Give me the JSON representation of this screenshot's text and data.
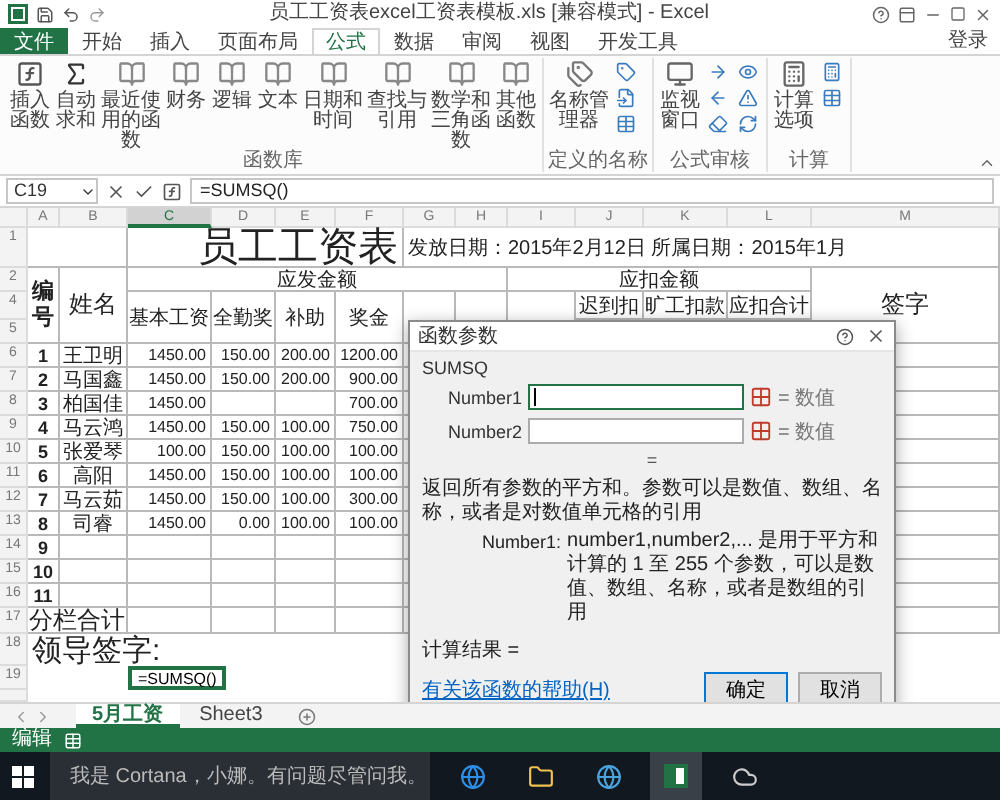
{
  "title_bar": {
    "title": "员工工资表excel工资表模板.xls [兼容模式] - Excel",
    "signin": "登录"
  },
  "ribbon_tabs": [
    {
      "label": "文件",
      "selected": false,
      "kind": "file"
    },
    {
      "label": "开始",
      "selected": false,
      "kind": "tab"
    },
    {
      "label": "插入",
      "selected": false,
      "kind": "tab"
    },
    {
      "label": "页面布局",
      "selected": false,
      "kind": "tab"
    },
    {
      "label": "公式",
      "selected": true,
      "kind": "tab"
    },
    {
      "label": "数据",
      "selected": false,
      "kind": "tab"
    },
    {
      "label": "审阅",
      "selected": false,
      "kind": "tab"
    },
    {
      "label": "视图",
      "selected": false,
      "kind": "tab"
    },
    {
      "label": "开发工具",
      "selected": false,
      "kind": "tab"
    }
  ],
  "ribbon_groups": [
    {
      "label": "函数库",
      "buttons": [
        {
          "label": "插入函数",
          "kind": "function"
        },
        {
          "label": "自动求和",
          "kind": "sigma"
        },
        {
          "label": "最近使用的函数",
          "kind": "book"
        },
        {
          "label": "财务",
          "kind": "book"
        },
        {
          "label": "逻辑",
          "kind": "book"
        },
        {
          "label": "文本",
          "kind": "book"
        },
        {
          "label": "日期和时间",
          "kind": "book"
        },
        {
          "label": "查找与引用",
          "kind": "book"
        },
        {
          "label": "数学和三角函数",
          "kind": "book"
        },
        {
          "label": "其他函数",
          "kind": "book"
        }
      ]
    },
    {
      "label": "定义的名称",
      "buttons": [
        {
          "label": "名称管理器",
          "kind": "tags"
        }
      ]
    },
    {
      "label": "公式审核",
      "buttons": [
        {
          "label": "监视窗口",
          "kind": "monitor"
        }
      ]
    },
    {
      "label": "计算",
      "buttons": [
        {
          "label": "计算选项",
          "kind": "calculator"
        }
      ]
    }
  ],
  "formula_bar": {
    "name_box": "C19",
    "formula": "=SUMSQ()"
  },
  "column_letters": [
    {
      "label": "A",
      "selected": false
    },
    {
      "label": "B",
      "selected": false
    },
    {
      "label": "C",
      "selected": true
    },
    {
      "label": "D",
      "selected": false
    },
    {
      "label": "E",
      "selected": false
    },
    {
      "label": "F",
      "selected": false
    },
    {
      "label": "G",
      "selected": false
    },
    {
      "label": "H",
      "selected": false
    },
    {
      "label": "I",
      "selected": false
    },
    {
      "label": "J",
      "selected": false
    },
    {
      "label": "K",
      "selected": false
    },
    {
      "label": "L",
      "selected": false
    },
    {
      "label": "M",
      "selected": false
    }
  ],
  "sheet": {
    "title": "员工工资表",
    "dates": "发放日期：2015年2月12日  所属日期：2015年1月",
    "header_row_numbers": [
      "1",
      "2",
      "4",
      "5"
    ],
    "header": {
      "number": "编号",
      "name": "姓名",
      "earned": "应发金额",
      "deducted": "应扣金额",
      "sign": "签字",
      "sub_earned": [
        "基本工资",
        "全勤奖",
        "补助",
        "奖金"
      ],
      "sub_deducted": [
        "迟到扣",
        "旷工扣款",
        "应扣合计"
      ]
    },
    "rows": [
      {
        "row": "6",
        "cells": [
          "1",
          "王卫明",
          "1450.00",
          "150.00",
          "200.00",
          "1200.00"
        ]
      },
      {
        "row": "7",
        "cells": [
          "2",
          "马国鑫",
          "1450.00",
          "150.00",
          "200.00",
          "900.00"
        ]
      },
      {
        "row": "8",
        "cells": [
          "3",
          "柏国佳",
          "1450.00",
          "",
          "",
          "700.00"
        ]
      },
      {
        "row": "9",
        "cells": [
          "4",
          "马云鸿",
          "1450.00",
          "150.00",
          "100.00",
          "750.00"
        ]
      },
      {
        "row": "10",
        "cells": [
          "5",
          "张爱琴",
          "100.00",
          "150.00",
          "100.00",
          "100.00"
        ]
      },
      {
        "row": "11",
        "cells": [
          "6",
          "高阳",
          "1450.00",
          "150.00",
          "100.00",
          "100.00"
        ]
      },
      {
        "row": "12",
        "cells": [
          "7",
          "马云茹",
          "1450.00",
          "150.00",
          "100.00",
          "300.00"
        ]
      },
      {
        "row": "13",
        "cells": [
          "8",
          "司睿",
          "1450.00",
          "0.00",
          "100.00",
          "100.00"
        ]
      },
      {
        "row": "14",
        "cells": [
          "9"
        ]
      },
      {
        "row": "15",
        "cells": [
          "10"
        ]
      },
      {
        "row": "16",
        "cells": [
          "11"
        ]
      }
    ],
    "subtotal": {
      "row": "17",
      "label": "分栏合计"
    },
    "signature": {
      "row": "18",
      "label": "领导签字:"
    },
    "active": {
      "row": "19",
      "value": "=SUMSQ()"
    }
  },
  "dialog": {
    "title": "函数参数",
    "function": "SUMSQ",
    "args": [
      {
        "label": "Number1",
        "focused": true,
        "result": "= 数值"
      },
      {
        "label": "Number2",
        "focused": false,
        "result": "= 数值"
      }
    ],
    "equals": "=",
    "description": "返回所有参数的平方和。参数可以是数值、数组、名称，或者是对数值单元格的引用",
    "arg_help_label": "Number1:",
    "arg_help": "number1,number2,... 是用于平方和计算的 1 至 255 个参数，可以是数值、数组、名称，或者是数组的引用",
    "result_label": "计算结果 =",
    "help_link": "有关该函数的帮助(H)",
    "buttons": [
      {
        "label": "确定",
        "default": true
      },
      {
        "label": "取消",
        "default": false
      }
    ]
  },
  "sheet_tabs": [
    {
      "label": "5月工资",
      "selected": true
    },
    {
      "label": "Sheet3",
      "selected": false
    }
  ],
  "status_bar": {
    "mode": "编辑"
  },
  "taskbar": {
    "search": "我是 Cortana，小娜。有问题尽管问我。"
  }
}
